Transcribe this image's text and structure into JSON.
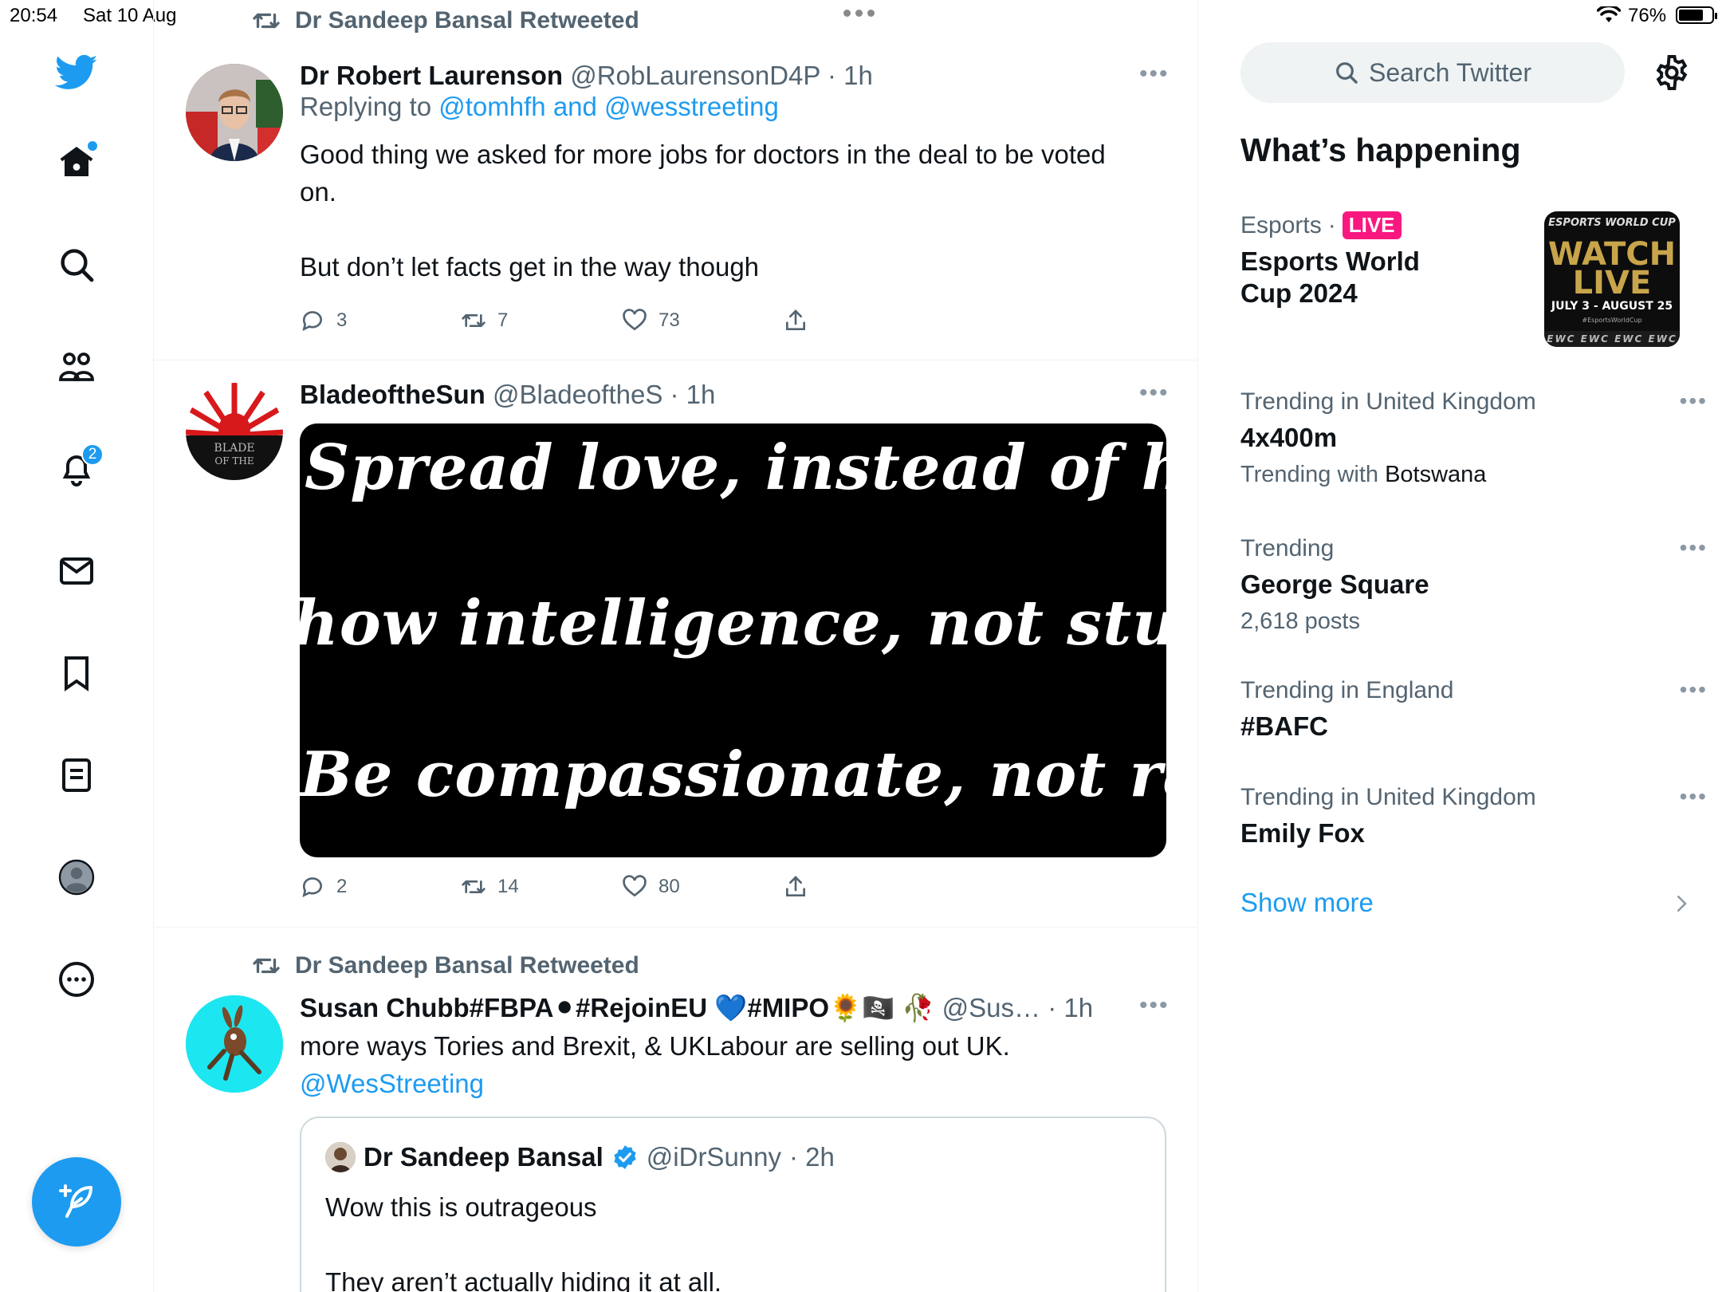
{
  "status_bar": {
    "time": "20:54",
    "date": "Sat 10 Aug",
    "battery": "76%",
    "battery_level": 0.76
  },
  "nav": {
    "notifications_badge": "2",
    "accent": "#1d9bf0"
  },
  "tweets": [
    {
      "retweeted_by": "Dr Sandeep Bansal Retweeted",
      "name": "Dr Robert Laurenson",
      "handle": "@RobLaurensonD4P",
      "time": "· 1h",
      "replying_prefix": "Replying to ",
      "replying_to": "@tomhfh and @wesstreeting",
      "text": "Good thing we asked for more jobs for doctors in the deal to be voted on.\n\nBut don’t let facts get in the way though",
      "replies": "3",
      "retweets": "7",
      "likes": "73"
    },
    {
      "name": "BladeoftheSun",
      "handle": "@BladeoftheS",
      "time": "· 1h",
      "avatar_text": "BLADE OF THE",
      "image_lines": [
        "Spread love, instead of hate",
        "how intelligence, not stupidit",
        "Be compassionate, not racist"
      ],
      "replies": "2",
      "retweets": "14",
      "likes": "80"
    },
    {
      "retweeted_by": "Dr Sandeep Bansal Retweeted",
      "name": "Susan Chubb#FBPA⚫#RejoinEU 💙#MIPO🌻🏴‍☠️ 🥀",
      "handle": "@Sus…",
      "time": "· 1h",
      "text": "more ways Tories and Brexit, & UKLabour are selling out UK.",
      "mention": "@WesStreeting",
      "quote": {
        "name": "Dr Sandeep Bansal",
        "handle": "@iDrSunny",
        "time": "· 2h",
        "text": "Wow this is outrageous\n\nThey aren’t actually hiding it at all."
      }
    }
  ],
  "sidebar": {
    "search_placeholder": "Search Twitter",
    "whats_happening": "What’s happening",
    "esports": {
      "category": "Esports",
      "dot": "·",
      "live": "LIVE",
      "title": "Esports World Cup 2024",
      "image_top": "ESPORTS WORLD CUP",
      "image_main": "WATCH LIVE",
      "image_dates": "JULY 3 - AUGUST 25",
      "image_tag": "#EsportsWorldCup",
      "image_strip": "EWC EWC EWC EWC"
    },
    "trends": [
      {
        "category": "Trending in United Kingdom",
        "title": "4x400m",
        "sub_prefix": "Trending with ",
        "sub_strong": "Botswana"
      },
      {
        "category": "Trending",
        "title": "George Square",
        "sub_prefix": "2,618 posts",
        "sub_strong": ""
      },
      {
        "category": "Trending in England",
        "title": "#BAFC"
      },
      {
        "category": "Trending in United Kingdom",
        "title": "Emily Fox"
      }
    ],
    "show_more": "Show more"
  }
}
